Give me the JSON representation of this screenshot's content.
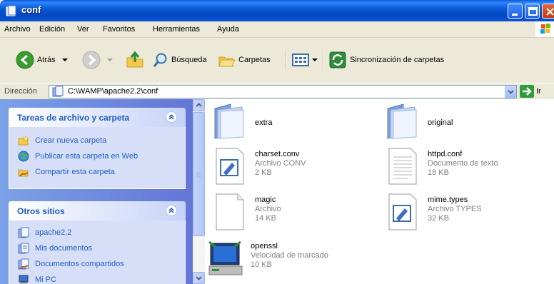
{
  "window": {
    "title": "conf"
  },
  "menu": [
    "Archivo",
    "Edición",
    "Ver",
    "Favoritos",
    "Herramientas",
    "Ayuda"
  ],
  "toolbar": {
    "back_label": "Atrás",
    "search_label": "Búsqueda",
    "folders_label": "Carpetas",
    "sync_label": "Sincronización de carpetas"
  },
  "address": {
    "label": "Dirección",
    "path": "C:\\WAMP\\apache2.2\\conf",
    "go_label": "Ir"
  },
  "tasks": {
    "title": "Tareas de archivo y carpeta",
    "items": [
      {
        "label": "Crear nueva carpeta",
        "icon": "new-folder-icon"
      },
      {
        "label": "Publicar esta carpeta en Web",
        "icon": "publish-web-icon"
      },
      {
        "label": "Compartir esta carpeta",
        "icon": "share-folder-icon"
      }
    ]
  },
  "other_places": {
    "title": "Otros sitios",
    "items": [
      {
        "label": "apache2.2",
        "icon": "folder-icon"
      },
      {
        "label": "Mis documentos",
        "icon": "my-documents-icon"
      },
      {
        "label": "Documentos compartidos",
        "icon": "shared-documents-icon"
      },
      {
        "label": "Mi PC",
        "icon": "my-computer-icon"
      }
    ]
  },
  "files": [
    {
      "name": "extra",
      "type": "",
      "size": "",
      "icon": "folder-icon"
    },
    {
      "name": "original",
      "type": "",
      "size": "",
      "icon": "folder-icon"
    },
    {
      "name": "charset.conv",
      "type": "Archivo CONV",
      "size": "2 KB",
      "icon": "text-file-icon"
    },
    {
      "name": "httpd.conf",
      "type": "Documento de texto",
      "size": "18 KB",
      "icon": "document-icon"
    },
    {
      "name": "magic",
      "type": "Archivo",
      "size": "14 KB",
      "icon": "blank-file-icon"
    },
    {
      "name": "mime.types",
      "type": "Archivo TYPES",
      "size": "32 KB",
      "icon": "text-file-icon"
    },
    {
      "name": "openssl",
      "type": "Velocidad de marcado",
      "size": "10 KB",
      "icon": "modem-icon"
    }
  ]
}
